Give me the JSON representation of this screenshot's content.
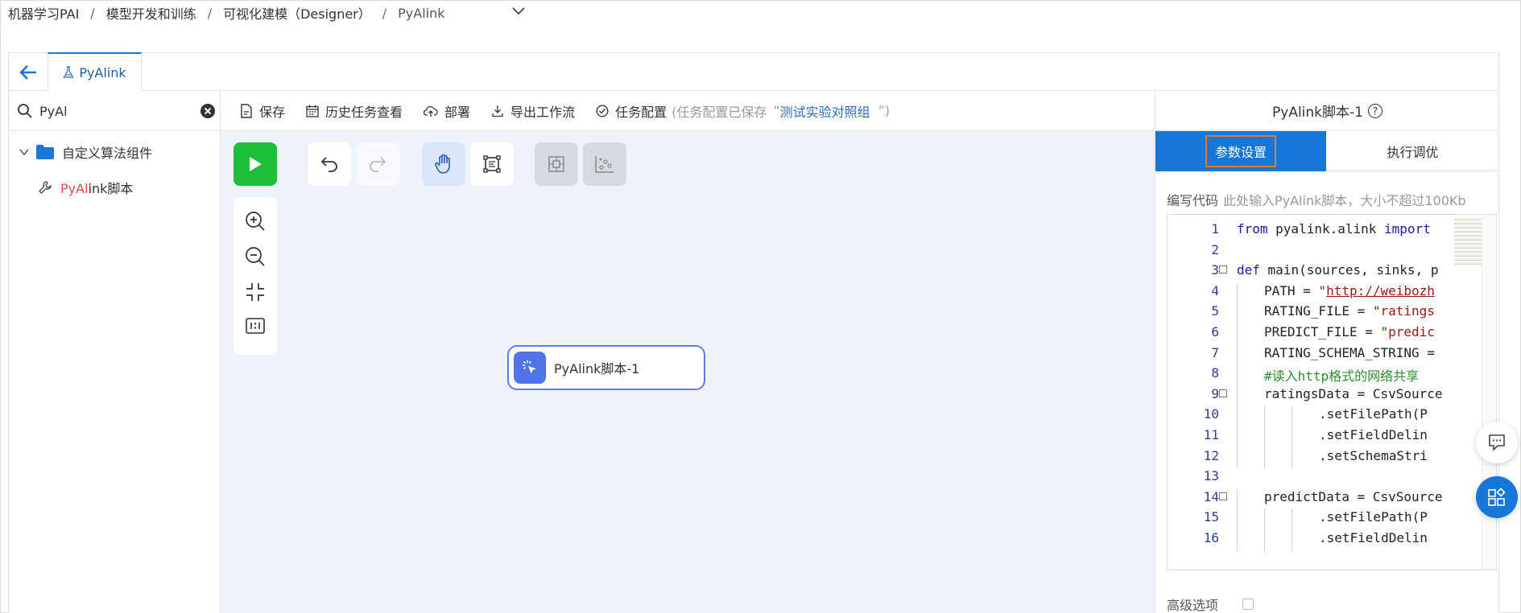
{
  "breadcrumb": {
    "items": [
      "机器学习PAI",
      "模型开发和训练",
      "可视化建模（Designer）",
      "PyAlink"
    ],
    "separator": "/"
  },
  "tab": {
    "label": "PyAlink"
  },
  "search": {
    "value": "PyAl"
  },
  "tree": {
    "folder_label": "自定义算法组件",
    "leaf_highlight": "PyAl",
    "leaf_rest": "ink脚本"
  },
  "toolbar": {
    "save": "保存",
    "history": "历史任务查看",
    "deploy": "部署",
    "export": "导出工作流",
    "task_config": "任务配置",
    "status_prefix": "(任务配置已保存",
    "status_quote_open": "“",
    "status_link": "测试实验对照组",
    "status_suffix": "”)"
  },
  "canvas": {
    "node_label": "PyAlink脚本-1"
  },
  "right_panel": {
    "title": "PyAlink脚本-1",
    "help_glyph": "?",
    "tab_params": "参数设置",
    "tab_debug": "执行调优",
    "code_label": "编写代码",
    "code_hint": "此处输入PyAlink脚本，大小不超过100Kb",
    "advanced_label": "高级选项",
    "code_lines": [
      {
        "n": "1",
        "fold": false,
        "indent": 0,
        "parts": [
          [
            "kw",
            "from"
          ],
          [
            "t",
            " pyalink.alink "
          ],
          [
            "kw",
            "import"
          ]
        ]
      },
      {
        "n": "2",
        "fold": false,
        "indent": 0,
        "parts": []
      },
      {
        "n": "3",
        "fold": true,
        "indent": 0,
        "parts": [
          [
            "kw",
            "def"
          ],
          [
            "t",
            " main(sources, sinks, p"
          ]
        ]
      },
      {
        "n": "4",
        "fold": false,
        "indent": 1,
        "parts": [
          [
            "t",
            "PATH = "
          ],
          [
            "str",
            "\""
          ],
          [
            "url",
            "http://weibozh"
          ]
        ]
      },
      {
        "n": "5",
        "fold": false,
        "indent": 1,
        "parts": [
          [
            "t",
            "RATING_FILE = "
          ],
          [
            "str",
            "\"ratings"
          ]
        ]
      },
      {
        "n": "6",
        "fold": false,
        "indent": 1,
        "parts": [
          [
            "t",
            "PREDICT_FILE = "
          ],
          [
            "str",
            "\"predic"
          ]
        ]
      },
      {
        "n": "7",
        "fold": false,
        "indent": 1,
        "parts": [
          [
            "t",
            "RATING_SCHEMA_STRING ="
          ]
        ]
      },
      {
        "n": "8",
        "fold": false,
        "indent": 1,
        "parts": [
          [
            "cmt",
            "#读入http格式的网络共享"
          ]
        ]
      },
      {
        "n": "9",
        "fold": true,
        "indent": 1,
        "parts": [
          [
            "t",
            "ratingsData = CsvSource"
          ]
        ]
      },
      {
        "n": "10",
        "fold": false,
        "indent": 3,
        "parts": [
          [
            "t",
            ".setFilePath(P"
          ]
        ]
      },
      {
        "n": "11",
        "fold": false,
        "indent": 3,
        "parts": [
          [
            "t",
            ".setFieldDelin"
          ]
        ]
      },
      {
        "n": "12",
        "fold": false,
        "indent": 3,
        "parts": [
          [
            "t",
            ".setSchemaStri"
          ]
        ]
      },
      {
        "n": "13",
        "fold": false,
        "indent": 0,
        "parts": []
      },
      {
        "n": "14",
        "fold": true,
        "indent": 1,
        "parts": [
          [
            "t",
            "predictData = CsvSource"
          ]
        ]
      },
      {
        "n": "15",
        "fold": false,
        "indent": 3,
        "parts": [
          [
            "t",
            ".setFilePath(P"
          ]
        ]
      },
      {
        "n": "16",
        "fold": false,
        "indent": 3,
        "parts": [
          [
            "t",
            ".setFieldDelin"
          ]
        ]
      }
    ]
  },
  "colors": {
    "accent": "#1677d9",
    "run_green": "#1dbe3a",
    "highlight_red": "#e5484d",
    "active_outline": "#e8762c",
    "canvas_bg": "#eef3fb"
  }
}
